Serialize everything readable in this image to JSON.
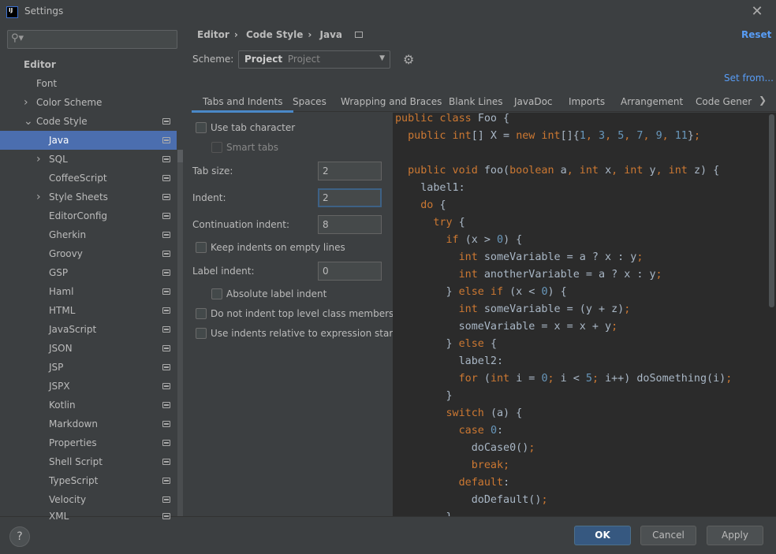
{
  "window": {
    "title": "Settings",
    "app_icon": "IJ"
  },
  "sidebar": {
    "search_placeholder": "",
    "items": [
      {
        "label": "Editor",
        "level": 0,
        "bold": true
      },
      {
        "label": "Font",
        "level": 1
      },
      {
        "label": "Color Scheme",
        "level": 1,
        "arrow": "right"
      },
      {
        "label": "Code Style",
        "level": 1,
        "arrow": "down",
        "badge": true
      },
      {
        "label": "Java",
        "level": 2,
        "badge": true,
        "selected": true
      },
      {
        "label": "SQL",
        "level": 2,
        "arrow": "right",
        "badge": true
      },
      {
        "label": "CoffeeScript",
        "level": 2,
        "badge": true
      },
      {
        "label": "Style Sheets",
        "level": 2,
        "arrow": "right",
        "badge": true
      },
      {
        "label": "EditorConfig",
        "level": 2,
        "badge": true
      },
      {
        "label": "Gherkin",
        "level": 2,
        "badge": true
      },
      {
        "label": "Groovy",
        "level": 2,
        "badge": true
      },
      {
        "label": "GSP",
        "level": 2,
        "badge": true
      },
      {
        "label": "Haml",
        "level": 2,
        "badge": true
      },
      {
        "label": "HTML",
        "level": 2,
        "badge": true
      },
      {
        "label": "JavaScript",
        "level": 2,
        "badge": true
      },
      {
        "label": "JSON",
        "level": 2,
        "badge": true
      },
      {
        "label": "JSP",
        "level": 2,
        "badge": true
      },
      {
        "label": "JSPX",
        "level": 2,
        "badge": true
      },
      {
        "label": "Kotlin",
        "level": 2,
        "badge": true
      },
      {
        "label": "Markdown",
        "level": 2,
        "badge": true
      },
      {
        "label": "Properties",
        "level": 2,
        "badge": true
      },
      {
        "label": "Shell Script",
        "level": 2,
        "badge": true
      },
      {
        "label": "TypeScript",
        "level": 2,
        "badge": true
      },
      {
        "label": "Velocity",
        "level": 2,
        "badge": true
      },
      {
        "label": "XML",
        "level": 2,
        "badge": true
      }
    ]
  },
  "header": {
    "breadcrumb": [
      "Editor",
      "Code Style",
      "Java"
    ],
    "reset": "Reset"
  },
  "scheme": {
    "label": "Scheme:",
    "value_bold": "Project",
    "value_sub": "Project",
    "set_from": "Set from..."
  },
  "tabs": [
    "Tabs and Indents",
    "Spaces",
    "Wrapping and Braces",
    "Blank Lines",
    "JavaDoc",
    "Imports",
    "Arrangement",
    "Code Gener"
  ],
  "options": {
    "use_tab_character": {
      "label": "Use tab character",
      "checked": false
    },
    "smart_tabs": {
      "label": "Smart tabs",
      "checked": false,
      "disabled": true
    },
    "tab_size": {
      "label": "Tab size:",
      "value": "2"
    },
    "indent": {
      "label": "Indent:",
      "value": "2"
    },
    "continuation_indent": {
      "label": "Continuation indent:",
      "value": "8"
    },
    "keep_indents": {
      "label": "Keep indents on empty lines",
      "checked": false
    },
    "label_indent": {
      "label": "Label indent:",
      "value": "0"
    },
    "absolute_label_indent": {
      "label": "Absolute label indent",
      "checked": false
    },
    "no_indent_top_level": {
      "label": "Do not indent top level class members",
      "checked": false
    },
    "relative_indents": {
      "label": "Use indents relative to expression start",
      "checked": false
    }
  },
  "code": [
    [
      [
        "public class ",
        "kw"
      ],
      [
        "Foo {",
        "txt"
      ]
    ],
    [
      [
        "  ",
        "txt"
      ],
      [
        "public int",
        "kw"
      ],
      [
        "[] X = ",
        "txt"
      ],
      [
        "new int",
        "kw"
      ],
      [
        "[]{",
        "txt"
      ],
      [
        "1",
        "num"
      ],
      [
        ", ",
        "kw"
      ],
      [
        "3",
        "num"
      ],
      [
        ", ",
        "kw"
      ],
      [
        "5",
        "num"
      ],
      [
        ", ",
        "kw"
      ],
      [
        "7",
        "num"
      ],
      [
        ", ",
        "kw"
      ],
      [
        "9",
        "num"
      ],
      [
        ", ",
        "kw"
      ],
      [
        "11",
        "num"
      ],
      [
        "}",
        "txt"
      ],
      [
        ";",
        "kw"
      ]
    ],
    [
      [
        "",
        "txt"
      ]
    ],
    [
      [
        "  ",
        "txt"
      ],
      [
        "public void ",
        "kw"
      ],
      [
        "foo(",
        "txt"
      ],
      [
        "boolean ",
        "kw"
      ],
      [
        "a",
        "txt"
      ],
      [
        ", int ",
        "kw"
      ],
      [
        "x",
        "txt"
      ],
      [
        ", int ",
        "kw"
      ],
      [
        "y",
        "txt"
      ],
      [
        ", int ",
        "kw"
      ],
      [
        "z) {",
        "txt"
      ]
    ],
    [
      [
        "    label1:",
        "txt"
      ]
    ],
    [
      [
        "    ",
        "txt"
      ],
      [
        "do ",
        "kw"
      ],
      [
        "{",
        "txt"
      ]
    ],
    [
      [
        "      ",
        "txt"
      ],
      [
        "try ",
        "kw"
      ],
      [
        "{",
        "txt"
      ]
    ],
    [
      [
        "        ",
        "txt"
      ],
      [
        "if ",
        "kw"
      ],
      [
        "(x > ",
        "txt"
      ],
      [
        "0",
        "num"
      ],
      [
        ") {",
        "txt"
      ]
    ],
    [
      [
        "          ",
        "txt"
      ],
      [
        "int ",
        "kw"
      ],
      [
        "someVariable = a ? x : y",
        "txt"
      ],
      [
        ";",
        "kw"
      ]
    ],
    [
      [
        "          ",
        "txt"
      ],
      [
        "int ",
        "kw"
      ],
      [
        "anotherVariable = a ? x : y",
        "txt"
      ],
      [
        ";",
        "kw"
      ]
    ],
    [
      [
        "        } ",
        "txt"
      ],
      [
        "else if ",
        "kw"
      ],
      [
        "(x < ",
        "txt"
      ],
      [
        "0",
        "num"
      ],
      [
        ") {",
        "txt"
      ]
    ],
    [
      [
        "          ",
        "txt"
      ],
      [
        "int ",
        "kw"
      ],
      [
        "someVariable = (y + z)",
        "txt"
      ],
      [
        ";",
        "kw"
      ]
    ],
    [
      [
        "          someVariable = x = x + y",
        "txt"
      ],
      [
        ";",
        "kw"
      ]
    ],
    [
      [
        "        } ",
        "txt"
      ],
      [
        "else ",
        "kw"
      ],
      [
        "{",
        "txt"
      ]
    ],
    [
      [
        "          label2:",
        "txt"
      ]
    ],
    [
      [
        "          ",
        "txt"
      ],
      [
        "for ",
        "kw"
      ],
      [
        "(",
        "txt"
      ],
      [
        "int ",
        "kw"
      ],
      [
        "i = ",
        "txt"
      ],
      [
        "0",
        "num"
      ],
      [
        "; ",
        "kw"
      ],
      [
        "i < ",
        "txt"
      ],
      [
        "5",
        "num"
      ],
      [
        "; ",
        "kw"
      ],
      [
        "i++) doSomething(i)",
        "txt"
      ],
      [
        ";",
        "kw"
      ]
    ],
    [
      [
        "        }",
        "txt"
      ]
    ],
    [
      [
        "        ",
        "txt"
      ],
      [
        "switch ",
        "kw"
      ],
      [
        "(a) {",
        "txt"
      ]
    ],
    [
      [
        "          ",
        "txt"
      ],
      [
        "case ",
        "kw"
      ],
      [
        "0",
        "num"
      ],
      [
        ":",
        "txt"
      ]
    ],
    [
      [
        "            doCase0()",
        "txt"
      ],
      [
        ";",
        "kw"
      ]
    ],
    [
      [
        "            ",
        "txt"
      ],
      [
        "break;",
        "kw"
      ]
    ],
    [
      [
        "          ",
        "txt"
      ],
      [
        "default",
        "kw"
      ],
      [
        ":",
        "txt"
      ]
    ],
    [
      [
        "            doDefault()",
        "txt"
      ],
      [
        ";",
        "kw"
      ]
    ],
    [
      [
        "        }",
        "txt"
      ]
    ]
  ],
  "footer": {
    "help": "?",
    "ok": "OK",
    "cancel": "Cancel",
    "apply": "Apply"
  },
  "colors": {
    "accent": "#4b6eaf",
    "keyword": "#cc7832",
    "number": "#6897bb",
    "text": "#a9b7c6",
    "link": "#589df6"
  }
}
